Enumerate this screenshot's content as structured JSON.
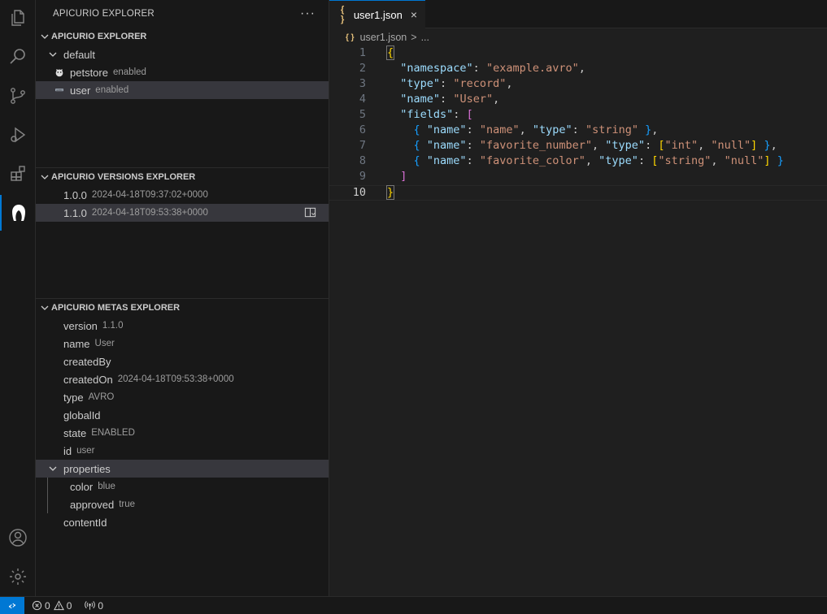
{
  "sidebar": {
    "title": "APICURIO EXPLORER",
    "more": "···",
    "explorer": {
      "header": "APICURIO EXPLORER",
      "group": "default",
      "items": [
        {
          "label": "petstore",
          "desc": "enabled"
        },
        {
          "label": "user",
          "desc": "enabled"
        }
      ]
    },
    "versions": {
      "header": "APICURIO VERSIONS EXPLORER",
      "items": [
        {
          "label": "1.0.0",
          "desc": "2024-04-18T09:37:02+0000"
        },
        {
          "label": "1.1.0",
          "desc": "2024-04-18T09:53:38+0000"
        }
      ]
    },
    "metas": {
      "header": "APICURIO METAS EXPLORER",
      "items": [
        {
          "label": "version",
          "desc": "1.1.0"
        },
        {
          "label": "name",
          "desc": "User"
        },
        {
          "label": "createdBy",
          "desc": ""
        },
        {
          "label": "createdOn",
          "desc": "2024-04-18T09:53:38+0000"
        },
        {
          "label": "type",
          "desc": "AVRO"
        },
        {
          "label": "globalId",
          "desc": ""
        },
        {
          "label": "state",
          "desc": "ENABLED"
        },
        {
          "label": "id",
          "desc": "user"
        }
      ],
      "properties": {
        "label": "properties",
        "children": [
          {
            "label": "color",
            "desc": "blue"
          },
          {
            "label": "approved",
            "desc": "true"
          }
        ]
      },
      "last": {
        "label": "contentId",
        "desc": ""
      }
    }
  },
  "editor": {
    "tab": {
      "icon": "{ }",
      "label": "user1.json",
      "close": "×"
    },
    "breadcrumb": {
      "icon": "{ }",
      "file": "user1.json",
      "sep": ">",
      "rest": "..."
    },
    "line_numbers": [
      "1",
      "2",
      "3",
      "4",
      "5",
      "6",
      "7",
      "8",
      "9",
      "10"
    ]
  },
  "statusbar": {
    "errors": "0",
    "warnings": "0",
    "ports": "0"
  },
  "icons": {
    "activity": [
      "files-icon",
      "search-icon",
      "source-control-icon",
      "run-debug-icon",
      "extensions-icon",
      "apicurio-icon",
      "account-icon",
      "settings-gear-icon"
    ]
  }
}
